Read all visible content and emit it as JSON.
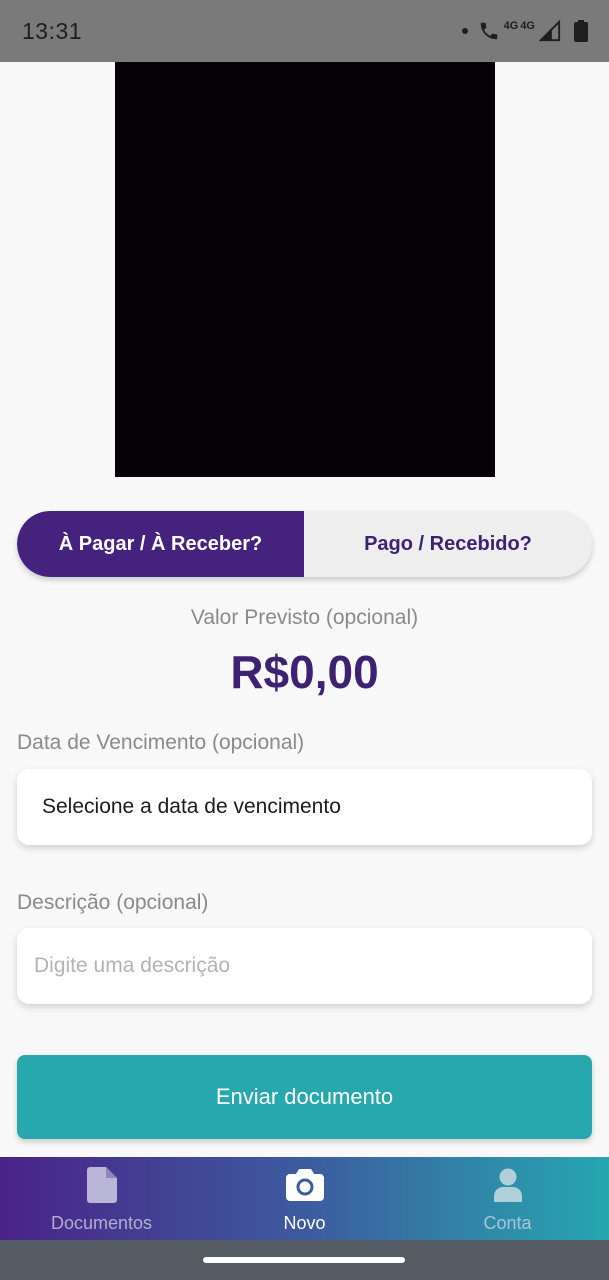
{
  "status_bar": {
    "time": "13:31",
    "network_label": "4G",
    "network_label_2": "4G",
    "icons": [
      "dot",
      "wifi-call-icon",
      "signal-icon",
      "battery-icon"
    ]
  },
  "camera": {
    "preview_icon": "camera-preview"
  },
  "toggle": {
    "active_label": "À Pagar / À Receber?",
    "inactive_label": "Pago / Recebido?",
    "active_color": "#44227e"
  },
  "amount": {
    "label": "Valor Previsto (opcional)",
    "value": "R$0,00"
  },
  "due_date": {
    "label": "Data de Vencimento (opcional)",
    "value": "Selecione a data de vencimento"
  },
  "description": {
    "label": "Descrição (opcional)",
    "placeholder": "Digite uma descrição",
    "value": ""
  },
  "send": {
    "label": "Enviar documento",
    "color": "#26a8ac"
  },
  "nav": {
    "items": [
      {
        "label": "Documentos",
        "icon": "document-icon",
        "active": false
      },
      {
        "label": "Novo",
        "icon": "camera-icon",
        "active": true
      },
      {
        "label": "Conta",
        "icon": "user-icon",
        "active": false
      }
    ]
  }
}
